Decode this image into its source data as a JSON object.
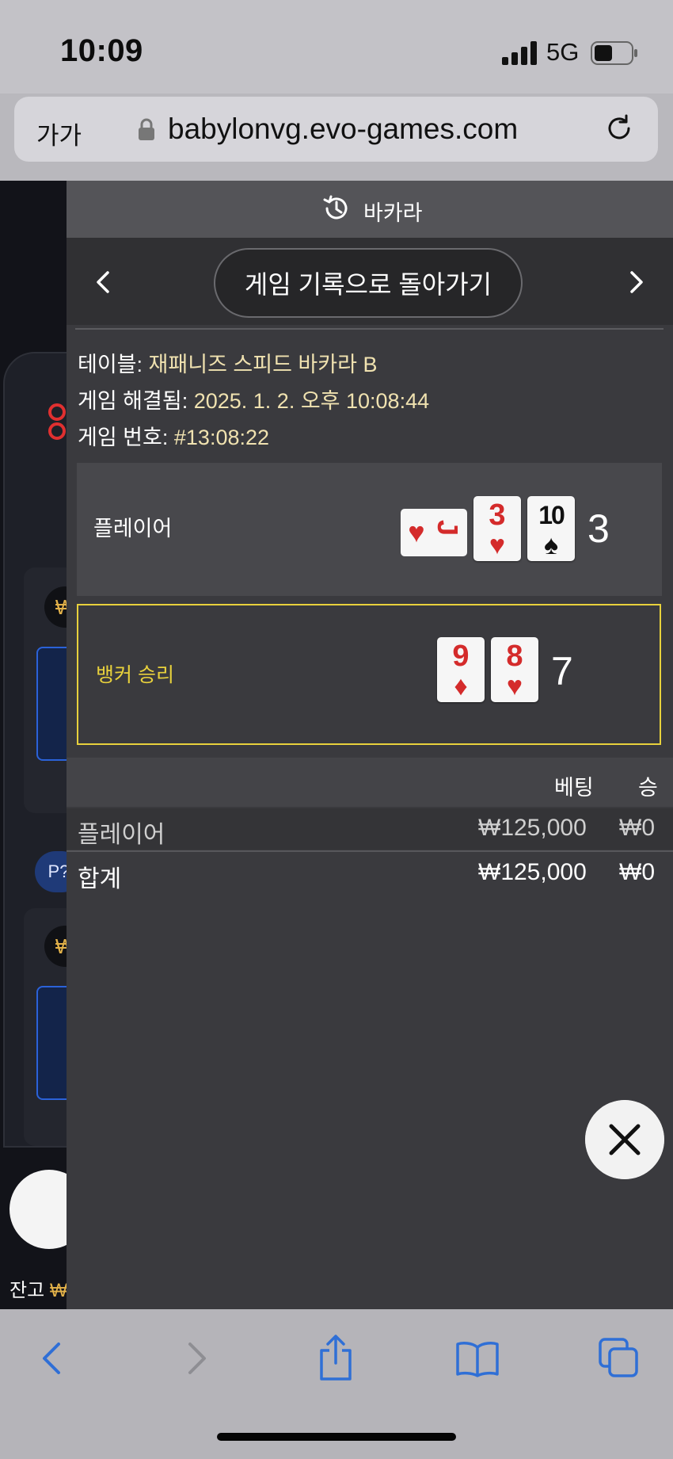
{
  "status_bar": {
    "time": "10:09",
    "network": "5G"
  },
  "browser": {
    "text_size_label": "가가",
    "url": "babylonvg.evo-games.com"
  },
  "background": {
    "won_badge": "₩",
    "p_badge": "P?",
    "balance_label": "잔고",
    "balance_symbol": "₩"
  },
  "modal": {
    "title": "바카라",
    "back_button": "게임 기록으로 돌아가기",
    "table_label": "테이블:",
    "table_value": "재패니즈 스피드 바카라 B",
    "resolved_label": "게임 해결됨:",
    "resolved_value": "2025. 1. 2. 오후 10:08:44",
    "game_no_label": "게임 번호:",
    "game_no_value": "#13:08:22",
    "player": {
      "label": "플레이어",
      "total": "3",
      "cards": [
        {
          "rank": "J",
          "suit": "♥",
          "color": "#d42b2b"
        },
        {
          "rank": "3",
          "suit": "♥",
          "color": "#d42b2b"
        },
        {
          "rank": "10",
          "suit": "♠",
          "color": "#111111"
        }
      ]
    },
    "banker": {
      "label": "뱅커 승리",
      "total": "7",
      "cards": [
        {
          "rank": "9",
          "suit": "♦",
          "color": "#d42b2b"
        },
        {
          "rank": "8",
          "suit": "♥",
          "color": "#d42b2b"
        }
      ]
    },
    "bets": {
      "headers": {
        "bet": "베팅",
        "win": "승"
      },
      "rows": [
        {
          "name": "플레이어",
          "bet": "₩125,000",
          "win": "₩0"
        },
        {
          "name": "합계",
          "bet": "₩125,000",
          "win": "₩0"
        }
      ]
    }
  },
  "colors": {
    "winner_highlight": "#e8d13c",
    "toolbar_blue": "#2f6fd6"
  }
}
